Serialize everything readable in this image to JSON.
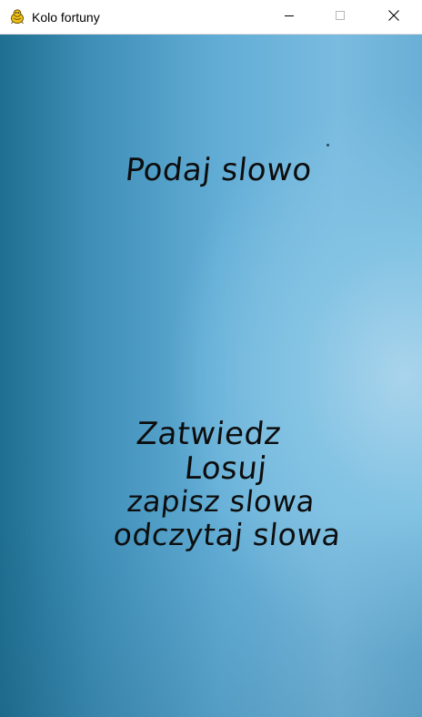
{
  "window": {
    "title": "Kolo fortuny",
    "icon": "pygame-snake-icon",
    "controls": {
      "minimize": "minimize-icon",
      "maximize": "maximize-icon",
      "close": "close-icon"
    }
  },
  "screen": {
    "prompt": "Podaj slowo",
    "menu": {
      "confirm": "Zatwiedz",
      "draw": "Losuj",
      "save_words": "zapisz slowa",
      "read_words": "odczytaj slowa"
    }
  },
  "colors": {
    "text": "#0d0d0d",
    "background_dark": "#1f6f91",
    "background_light": "#a9d4ec"
  }
}
